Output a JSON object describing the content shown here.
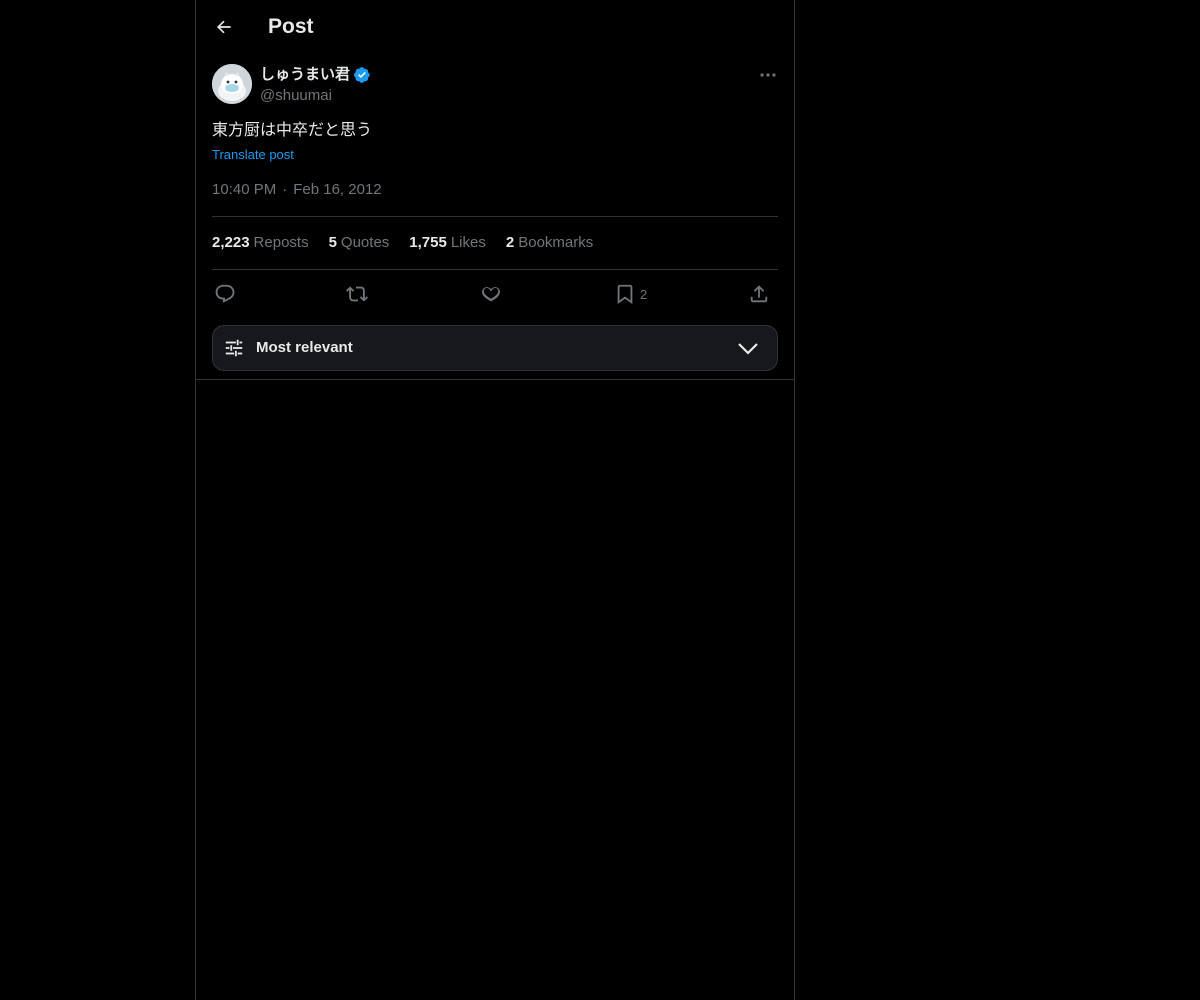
{
  "header": {
    "back_icon": "arrow-left-icon",
    "title": "Post"
  },
  "post": {
    "author": {
      "name": "しゅうまい君",
      "handle": "@shuumai",
      "verified": true,
      "verified_color": "#1d9bf0"
    },
    "text": "東方厨は中卒だと思う",
    "translate_label": "Translate post",
    "time": "10:40 PM",
    "separator": "·",
    "date": "Feb 16, 2012",
    "stats": [
      {
        "count": "2,223",
        "label": "Reposts"
      },
      {
        "count": "5",
        "label": "Quotes"
      },
      {
        "count": "1,755",
        "label": "Likes"
      },
      {
        "count": "2",
        "label": "Bookmarks"
      }
    ],
    "actions": {
      "reply_icon": "reply-icon",
      "repost_icon": "repost-icon",
      "like_icon": "heart-icon",
      "bookmark_icon": "bookmark-icon",
      "bookmark_count": "2",
      "share_icon": "share-icon"
    }
  },
  "replies_sort": {
    "icon": "sliders-icon",
    "label": "Most relevant",
    "chevron_icon": "chevron-down-icon"
  },
  "colors": {
    "background": "#000000",
    "text_primary": "#e7e9ea",
    "text_secondary": "#71767b",
    "accent": "#1d9bf0",
    "border": "#2f3336"
  }
}
